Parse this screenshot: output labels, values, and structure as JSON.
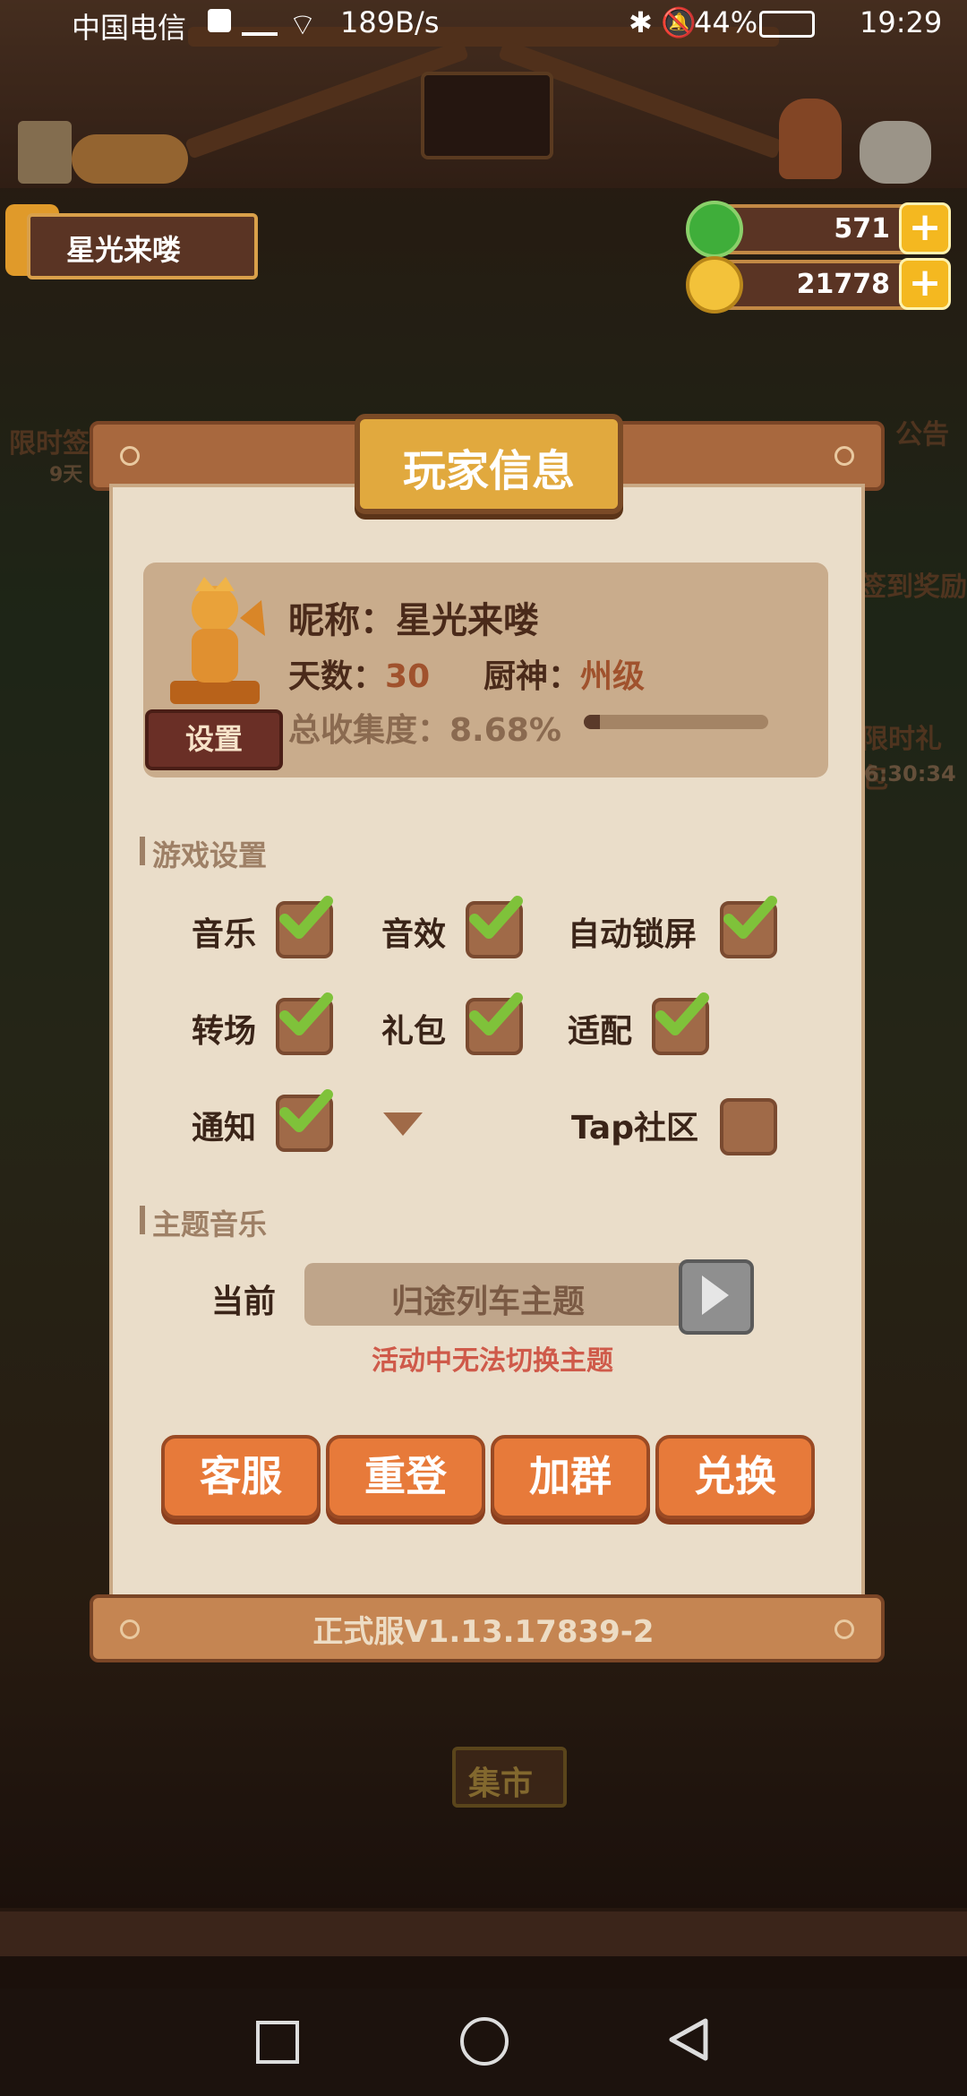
{
  "status_bar": {
    "carrier": "中国电信",
    "net": "189B/s",
    "battery": "44%",
    "time": "19:29"
  },
  "hud": {
    "player_name": "星光来喽",
    "currency_green": "571",
    "currency_coin": "21778"
  },
  "background_hints": {
    "limited_time": "限时签",
    "days": "9天",
    "notice": "公告",
    "sign_reward": "签到奖励",
    "gift_timer": "6:30:34",
    "market": "集市",
    "gift": "限时礼包"
  },
  "dialog": {
    "title": "玩家信息",
    "settings_btn": "设置",
    "nickname_label": "昵称：星光来喽",
    "days_label": "天数：",
    "days_value": "30",
    "chef_label": "厨神：",
    "chef_value": "州级",
    "collection_label": "总收集度：8.68%",
    "collection_progress": 0.0868,
    "game_settings_title": "游戏设置",
    "options": [
      {
        "label": "音乐",
        "checked": true
      },
      {
        "label": "音效",
        "checked": true
      },
      {
        "label": "自动锁屏",
        "checked": true
      },
      {
        "label": "转场",
        "checked": true
      },
      {
        "label": "礼包",
        "checked": true
      },
      {
        "label": "适配",
        "checked": true
      },
      {
        "label": "通知",
        "checked": true
      },
      {
        "label": "Tap社区",
        "checked": false
      }
    ],
    "theme_music_title": "主题音乐",
    "current_label": "当前",
    "current_theme": "归途列车主题",
    "theme_warning": "活动中无法切换主题",
    "buttons": [
      "客服",
      "重登",
      "加群",
      "兑换"
    ],
    "version": "正式服V1.13.17839-2"
  },
  "colors": {
    "accent_orange": "#e77a3a",
    "paper": "#eaddc9",
    "check_green": "#7fc23a"
  }
}
